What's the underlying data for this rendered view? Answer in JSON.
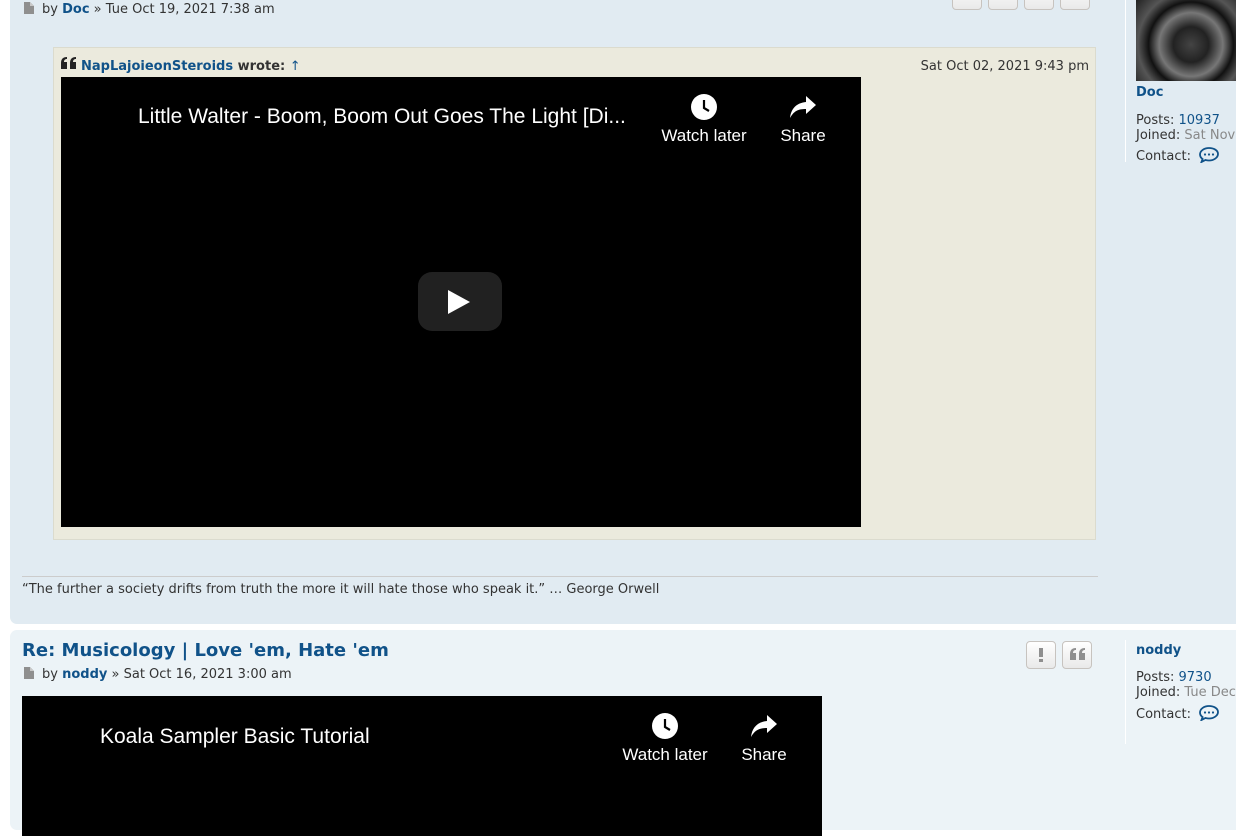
{
  "post1": {
    "by_label": "by",
    "author": "Doc",
    "date": "» Tue Oct 19, 2021 7:38 am",
    "quote": {
      "author": "NapLajoieonSteroids",
      "wrote_label": "wrote:",
      "up_arrow": "↑",
      "date": "Sat Oct 02, 2021 9:43 pm"
    },
    "video": {
      "title": "Little Walter - Boom, Boom Out Goes The Light [Di...",
      "watch_later": "Watch later",
      "share": "Share"
    },
    "signature": "“The further a society drifts from truth the more it will hate those who speak it.” … George Orwell",
    "profile": {
      "name": "Doc",
      "posts_label": "Posts:",
      "posts": "10937",
      "joined_label": "Joined:",
      "joined": "Sat Nov",
      "contact_label": "Contact:"
    }
  },
  "post2": {
    "title": "Re: Musicology | Love 'em, Hate 'em",
    "by_label": "by",
    "author": "noddy",
    "date": "» Sat Oct 16, 2021 3:00 am",
    "video": {
      "title": "Koala Sampler Basic Tutorial",
      "watch_later": "Watch later",
      "share": "Share"
    },
    "profile": {
      "name": "noddy",
      "posts_label": "Posts:",
      "posts": "9730",
      "joined_label": "Joined:",
      "joined": "Tue Dec",
      "contact_label": "Contact:"
    }
  },
  "colors": {
    "link": "#105289",
    "post_bg_1": "#e1ebf2",
    "post_bg_2": "#ecf3f7",
    "quote_bg": "#ebeadd"
  },
  "icons": [
    "file-icon",
    "quote-icon",
    "clock-icon",
    "share-icon",
    "play-icon",
    "report-icon",
    "chat-icon"
  ]
}
